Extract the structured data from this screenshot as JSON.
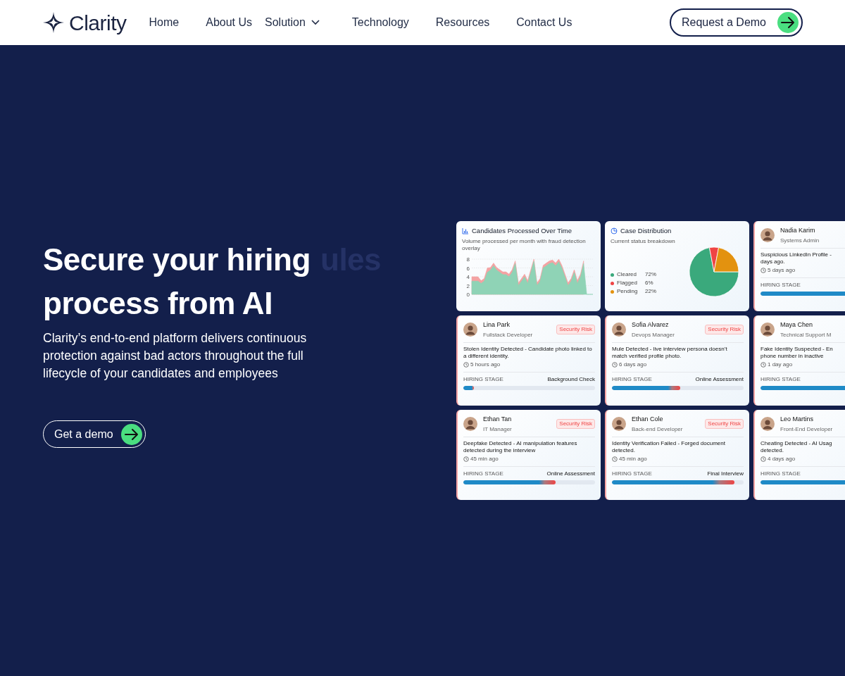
{
  "nav": {
    "logo": "Clarity",
    "links": [
      {
        "label": "Home",
        "dropdown": false
      },
      {
        "label": "About Us",
        "dropdown": false
      },
      {
        "label": "Solution",
        "dropdown": true
      },
      {
        "label": "Technology",
        "dropdown": false
      },
      {
        "label": "Resources",
        "dropdown": false
      },
      {
        "label": "Contact Us",
        "dropdown": false
      }
    ],
    "cta": "Request a Demo"
  },
  "hero": {
    "headline": "Secure your hiring process from AI",
    "ghost": "ules",
    "text": "Clarity’s end-to-end platform delivers continuous protection against bad actors throughout the full lifecycle of your candidates and employees",
    "button": "Get a demo"
  },
  "cards": [
    {
      "kind": "area_chart",
      "title": "Candidates Processed Over Time",
      "subtitle": "Volume processed per month with fraud detection overlay",
      "chart_data": {
        "type": "area",
        "grid": true,
        "yticks": [
          0,
          2,
          4,
          6,
          8
        ],
        "ylim": [
          0,
          8
        ],
        "series": [
          {
            "color": "#8fd3b6",
            "values": [
              3,
              3,
              3,
              2.5,
              3,
              5,
              5.5,
              6.5,
              5.5,
              5,
              4.5,
              4.5,
              4,
              5,
              7,
              2,
              3,
              4,
              2.5,
              5,
              7.5,
              2,
              3,
              6,
              6.5,
              7,
              7.2,
              6.5,
              7.4,
              6,
              4,
              2,
              3,
              5,
              2.5,
              4,
              7,
              0,
              0,
              0
            ]
          },
          {
            "color": "#f4a3a3",
            "values": [
              4,
              4,
              4,
              3.1,
              3.6,
              6,
              6.1,
              7.1,
              6.1,
              5.6,
              5.1,
              5.1,
              4.6,
              5.6,
              7.6,
              2.6,
              3.6,
              4.6,
              3.1,
              5.6,
              8,
              2.6,
              3.6,
              6.6,
              7.1,
              7.6,
              7.8,
              7.1,
              8,
              6.6,
              4.6,
              2.6,
              3.6,
              5.6,
              3.1,
              4.6,
              7.6,
              null,
              null,
              null
            ]
          }
        ]
      }
    },
    {
      "kind": "pie_chart",
      "title": "Case Distribution",
      "subtitle": "Current status breakdown",
      "legend": [
        {
          "label": "Cleared",
          "value": "72%",
          "color": "#3aa97c"
        },
        {
          "label": "Flagged",
          "value": "6%",
          "color": "#ef4444"
        },
        {
          "label": "Pending",
          "value": "22%",
          "color": "#e3920f"
        }
      ],
      "chart_data": {
        "type": "pie",
        "values": [
          72,
          6,
          22
        ]
      }
    },
    {
      "kind": "person",
      "name": "Nadia Karim",
      "role": "Systems Admin",
      "lines": [
        "Suspicious LinkedIn Profile -",
        "days ago."
      ],
      "time": "5 days ago",
      "stage_label": "HIRING STAGE",
      "level": 1
    },
    {
      "kind": "person",
      "name": "Lina Park",
      "role": "Fullstack Developer",
      "badge": "Security Risk",
      "description": "Stolen Identity Detected - Candidate photo linked to a different identity.",
      "time": "5 hours ago",
      "stage_label": "HIRING STAGE",
      "stage": "Background Check",
      "level": 0.08
    },
    {
      "kind": "person",
      "name": "Sofia Alvarez",
      "role": "Devops Manager",
      "badge": "Security Risk",
      "description": "Mule Detected - live interview persona doesn’t match verified profile photo.",
      "time": "6 days ago",
      "stage_label": "HIRING STAGE",
      "stage": "Online Assessment",
      "level": 0.52
    },
    {
      "kind": "person",
      "name": "Maya Chen",
      "role": "Technical Support M",
      "lines": [
        "Fake Identity Suspected - En",
        "phone number in inactive"
      ],
      "time": "1 day ago",
      "stage_label": "HIRING STAGE",
      "level": 1
    },
    {
      "kind": "person",
      "name": "Ethan Tan",
      "role": "IT Manager",
      "badge": "Security Risk",
      "description": "Deepfake Detected - AI manipulation features detected during the interview",
      "time": "45 min ago",
      "stage_label": "HIRING STAGE",
      "stage": "Online Assessment",
      "level": 0.7
    },
    {
      "kind": "person",
      "name": "Ethan Cole",
      "role": "Back-end Developer",
      "badge": "Security Risk",
      "description": "Identity Verification Failed - Forged document detected.",
      "time": "45 min ago",
      "stage_label": "HIRING STAGE",
      "stage": "Final Interview",
      "level": 0.93
    },
    {
      "kind": "person",
      "name": "Leo Martins",
      "role": "Front-End Developer",
      "lines": [
        "Cheating Detected - AI Usag",
        "detected."
      ],
      "time": "4 days ago",
      "stage_label": "HIRING STAGE",
      "level": 0.92
    }
  ]
}
